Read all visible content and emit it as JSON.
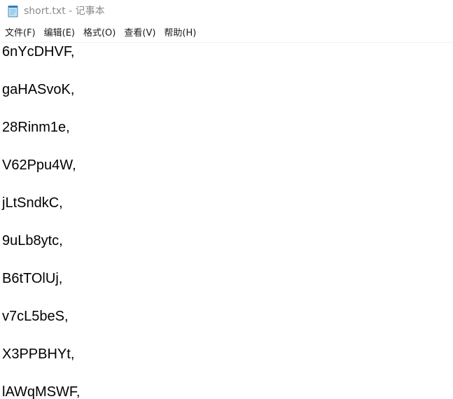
{
  "window": {
    "title": "short.txt - 记事本",
    "app_icon": "notepad-icon"
  },
  "menu": {
    "items": [
      {
        "label": "文件(F)"
      },
      {
        "label": "编辑(E)"
      },
      {
        "label": "格式(O)"
      },
      {
        "label": "查看(V)"
      },
      {
        "label": "帮助(H)"
      }
    ]
  },
  "editor": {
    "lines": [
      "6nYcDHVF,",
      "",
      "gaHASvoK,",
      "",
      "28Rinm1e,",
      "",
      "V62Ppu4W,",
      "",
      "jLtSndkC,",
      "",
      "9uLb8ytc,",
      "",
      "B6tTOlUj,",
      "",
      "v7cL5beS,",
      "",
      "X3PPBHYt,",
      "",
      "lAWqMSWF,"
    ]
  }
}
